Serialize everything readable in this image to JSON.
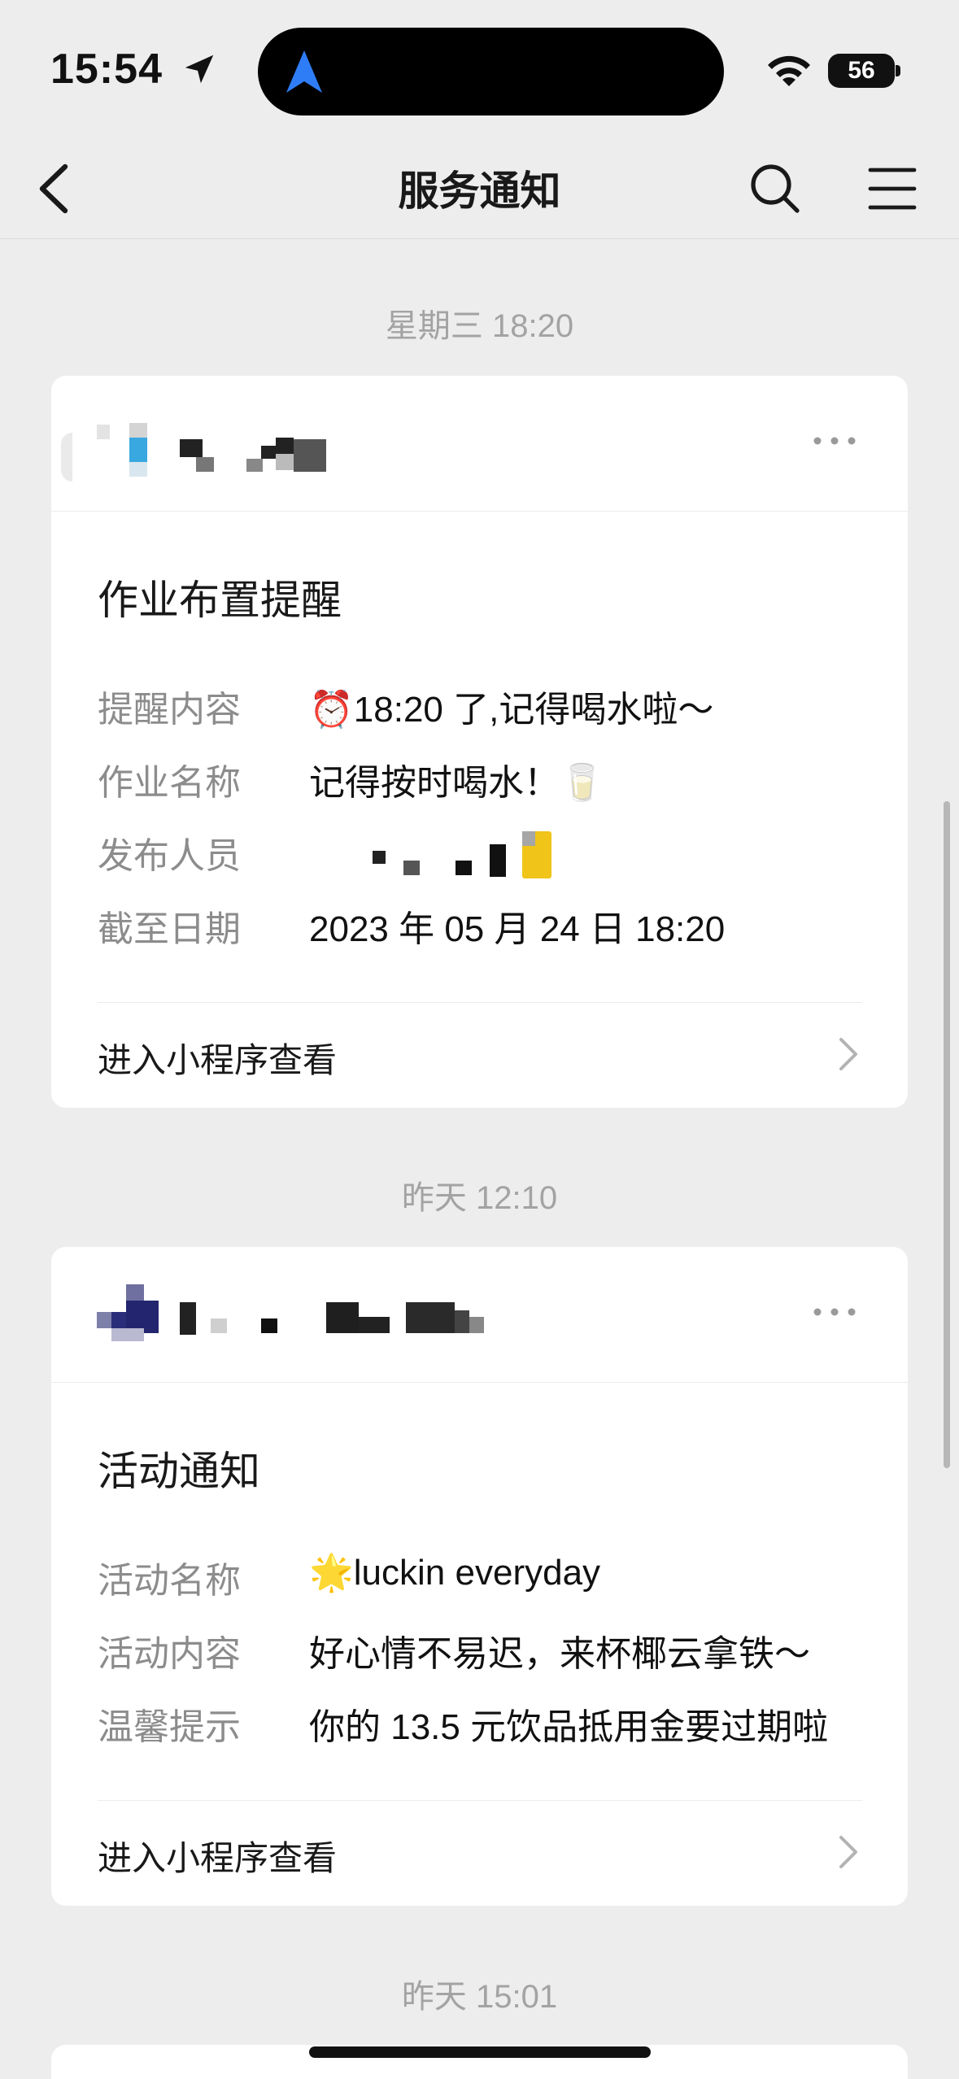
{
  "status": {
    "time": "15:54",
    "battery": "56"
  },
  "nav": {
    "title": "服务通知"
  },
  "messages": [
    {
      "timestamp": "星期三 18:20",
      "title": "作业布置提醒",
      "fields": [
        {
          "label": "提醒内容",
          "value": "⏰18:20 了,记得喝水啦～"
        },
        {
          "label": "作业名称",
          "value": "记得按时喝水！🥛"
        },
        {
          "label": "发布人员",
          "value": ""
        },
        {
          "label": "截至日期",
          "value": "2023 年 05 月 24 日 18:20"
        }
      ],
      "link": "进入小程序查看"
    },
    {
      "timestamp": "昨天 12:10",
      "title": "活动通知",
      "fields": [
        {
          "label": "活动名称",
          "value": "🌟luckin everyday"
        },
        {
          "label": "活动内容",
          "value": "好心情不易迟，来杯椰云拿铁～"
        },
        {
          "label": "温馨提示",
          "value": "你的 13.5 元饮品抵用金要过期啦"
        }
      ],
      "link": "进入小程序查看"
    },
    {
      "timestamp": "昨天 15:01"
    }
  ]
}
